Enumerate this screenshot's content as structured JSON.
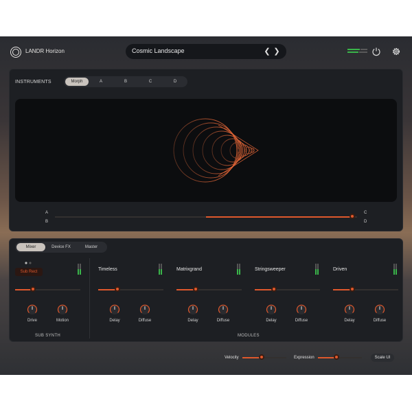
{
  "header": {
    "brand": "LANDR Horizon",
    "preset_name": "Cosmic Landscape",
    "prev_icon": "chevron-left-icon",
    "next_icon": "chevron-right-icon",
    "power_icon": "power-icon",
    "settings_icon": "gear-icon"
  },
  "instruments": {
    "label": "INSTRUMENTS",
    "tabs": [
      "Morph",
      "A",
      "B",
      "C",
      "D"
    ],
    "active_tab": "Morph"
  },
  "morph": {
    "corner_a": "A",
    "corner_b": "B",
    "corner_c": "C",
    "corner_d": "D",
    "position": 0.95
  },
  "mixer_tabs": [
    "Mixer",
    "Device FX",
    "Master"
  ],
  "active_mixer_tab": "Mixer",
  "sub_synth": {
    "type_label": "Sub Rect",
    "level": 0.3,
    "knobs": [
      "Drive",
      "Motion"
    ],
    "footer": "SUB SYNTH"
  },
  "modules": [
    {
      "title": "Timeless",
      "level": 0.3,
      "knobs": [
        "Delay",
        "Diffuse"
      ]
    },
    {
      "title": "Matrixgrand",
      "level": 0.3,
      "knobs": [
        "Delay",
        "Diffuse"
      ]
    },
    {
      "title": "Stringsweeper",
      "level": 0.3,
      "knobs": [
        "Delay",
        "Diffuse"
      ]
    },
    {
      "title": "Driven",
      "level": 0.3,
      "knobs": [
        "Delay",
        "Diffuse"
      ]
    }
  ],
  "modules_footer": "MODULES",
  "bottom": {
    "velocity_label": "Velocity",
    "velocity": 0.5,
    "expression_label": "Expression",
    "expression": 0.42,
    "scale_label": "Scale UI"
  },
  "colors": {
    "accent": "#e0582c",
    "meter_green": "#3ab54a"
  }
}
